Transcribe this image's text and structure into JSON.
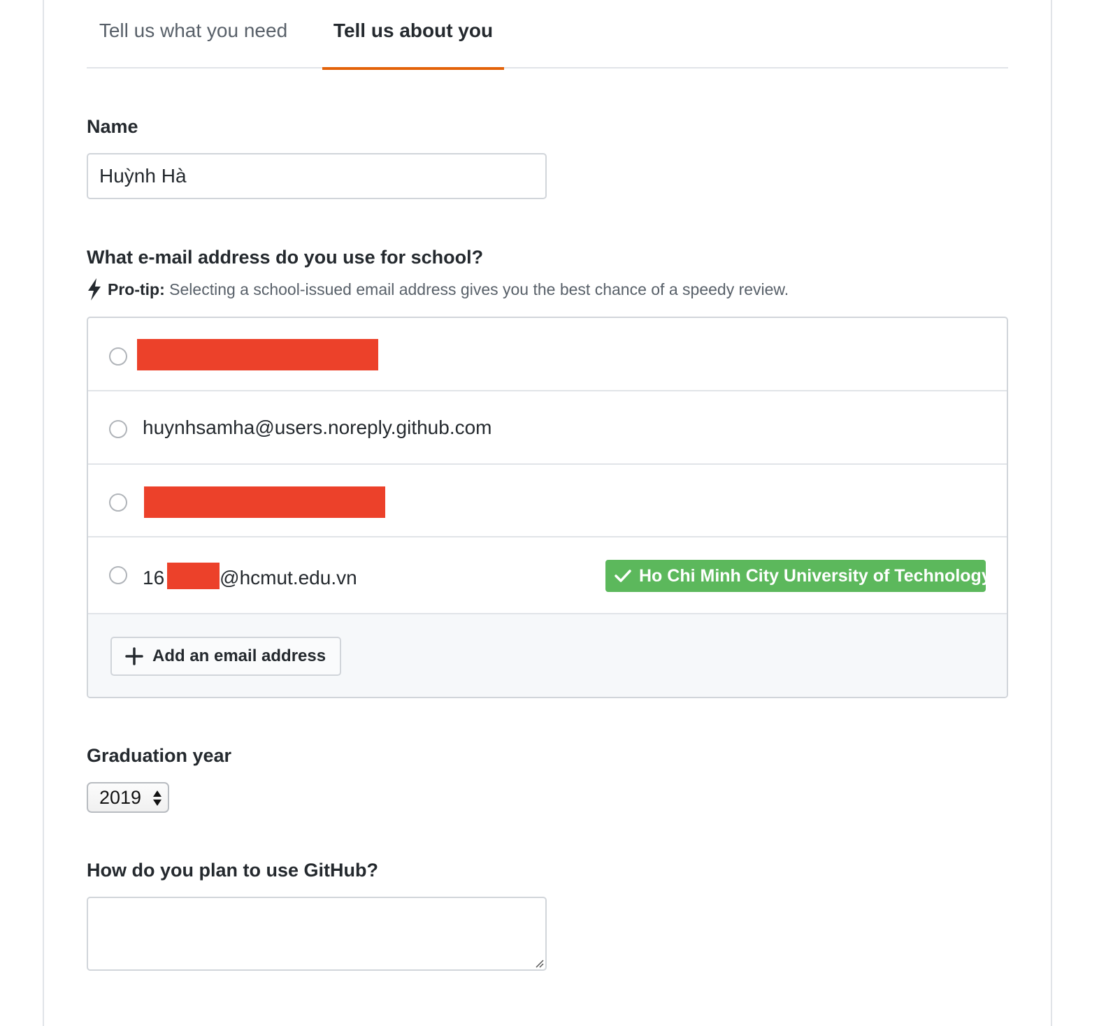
{
  "tabs": {
    "need": "Tell us what you need",
    "about": "Tell us about you"
  },
  "name": {
    "label": "Name",
    "value": "Huỳnh Hà"
  },
  "email": {
    "label": "What e-mail address do you use for school?",
    "protip_bold": "Pro-tip:",
    "protip_text": " Selecting a school-issued email address gives you the best chance of a speedy review.",
    "options": [
      {
        "value": ""
      },
      {
        "value": "huynhsamha@users.noreply.github.com"
      },
      {
        "value": ""
      },
      {
        "prefix": "16",
        "suffix": "@hcmut.edu.vn",
        "badge": "Ho Chi Minh City University of Technology"
      }
    ],
    "add_button": "Add an email address",
    "redaction_color": "#ec412a",
    "badge_color": "#5cb85c"
  },
  "graduation": {
    "label": "Graduation year",
    "selected": "2019"
  },
  "usage": {
    "label": "How do you plan to use GitHub?",
    "value": ""
  },
  "accent_color": "#e36209"
}
